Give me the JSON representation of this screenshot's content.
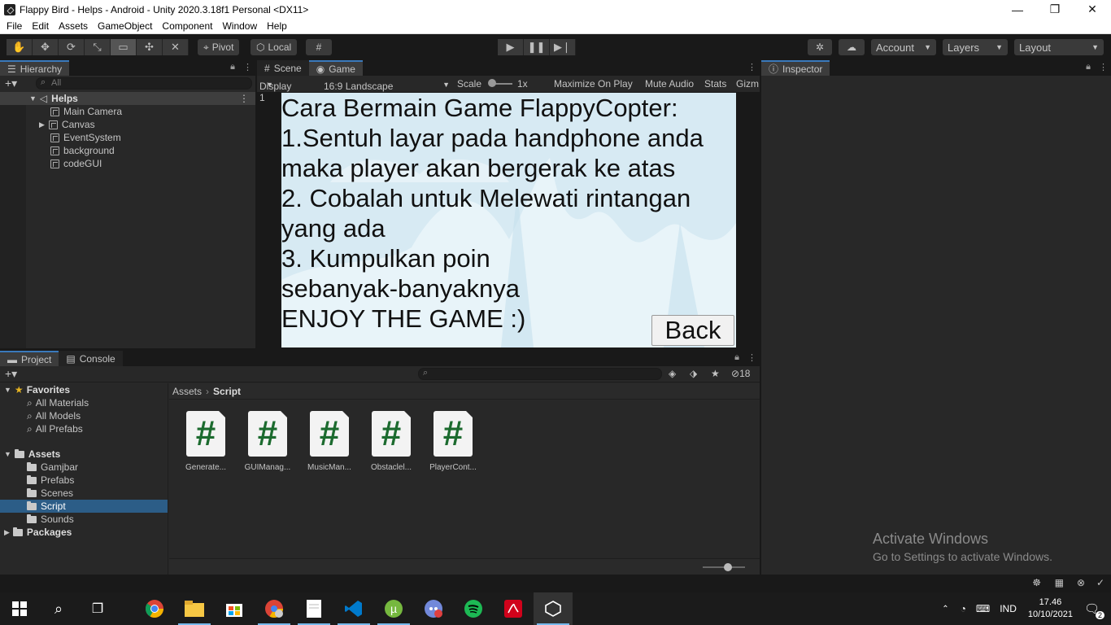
{
  "window": {
    "title": "Flappy Bird - Helps - Android - Unity 2020.3.18f1 Personal <DX11>",
    "minimize": "—",
    "restore": "❐",
    "close": "✕"
  },
  "menu": [
    "File",
    "Edit",
    "Assets",
    "GameObject",
    "Component",
    "Window",
    "Help"
  ],
  "toolbar": {
    "pivot_label": "Pivot",
    "local_label": "Local",
    "account_label": "Account",
    "layers_label": "Layers",
    "layout_label": "Layout"
  },
  "hierarchy": {
    "tab_label": "Hierarchy",
    "search_placeholder": "All",
    "scene_name": "Helps",
    "items": [
      "Main Camera",
      "Canvas",
      "EventSystem",
      "background",
      "codeGUI"
    ]
  },
  "scene_tabs": {
    "scene_label": "Scene",
    "game_label": "Game"
  },
  "game_bar": {
    "display": "Display 1",
    "aspect": "16:9 Landscape",
    "scale_label": "Scale",
    "scale_value": "1x",
    "maximize": "Maximize On Play",
    "mute": "Mute Audio",
    "stats": "Stats",
    "gizmos": "Gizm"
  },
  "game_view": {
    "text": "Cara Bermain Game FlappyCopter:\n1.Sentuh layar pada handphone anda\nmaka player akan bergerak ke atas\n2. Cobalah untuk Melewati rintangan\nyang ada\n3. Kumpulkan poin\nsebanyak-banyaknya\nENJOY THE GAME :)",
    "back_label": "Back"
  },
  "inspector": {
    "tab_label": "Inspector"
  },
  "project": {
    "tab_label": "Project",
    "console_label": "Console",
    "hidden_count": "18",
    "favorites_label": "Favorites",
    "favorites": [
      "All Materials",
      "All Models",
      "All Prefabs"
    ],
    "assets_label": "Assets",
    "folders": [
      "Gamjbar",
      "Prefabs",
      "Scenes",
      "Script",
      "Sounds"
    ],
    "packages_label": "Packages",
    "breadcrumb_root": "Assets",
    "breadcrumb_current": "Script",
    "scripts": [
      "Generate...",
      "GUIManag...",
      "MusicMan...",
      "Obstaclel...",
      "PlayerCont..."
    ],
    "script_glyph": "#"
  },
  "watermark": {
    "line1": "Activate Windows",
    "line2": "Go to Settings to activate Windows."
  },
  "taskbar": {
    "lang": "IND",
    "time": "17.46",
    "date": "10/10/2021",
    "notification_count": "2"
  }
}
